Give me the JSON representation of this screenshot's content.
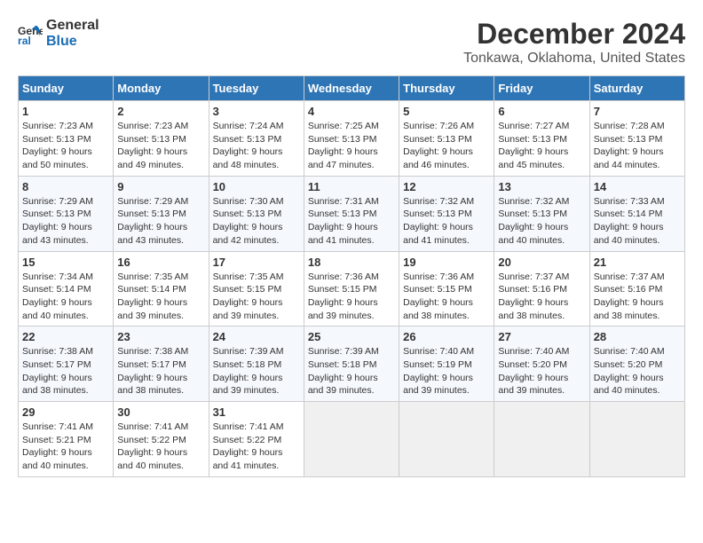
{
  "header": {
    "logo_line1": "General",
    "logo_line2": "Blue",
    "title": "December 2024",
    "subtitle": "Tonkawa, Oklahoma, United States"
  },
  "weekdays": [
    "Sunday",
    "Monday",
    "Tuesday",
    "Wednesday",
    "Thursday",
    "Friday",
    "Saturday"
  ],
  "weeks": [
    [
      {
        "day": 1,
        "sunrise": "Sunrise: 7:23 AM",
        "sunset": "Sunset: 5:13 PM",
        "daylight": "Daylight: 9 hours and 50 minutes."
      },
      {
        "day": 2,
        "sunrise": "Sunrise: 7:23 AM",
        "sunset": "Sunset: 5:13 PM",
        "daylight": "Daylight: 9 hours and 49 minutes."
      },
      {
        "day": 3,
        "sunrise": "Sunrise: 7:24 AM",
        "sunset": "Sunset: 5:13 PM",
        "daylight": "Daylight: 9 hours and 48 minutes."
      },
      {
        "day": 4,
        "sunrise": "Sunrise: 7:25 AM",
        "sunset": "Sunset: 5:13 PM",
        "daylight": "Daylight: 9 hours and 47 minutes."
      },
      {
        "day": 5,
        "sunrise": "Sunrise: 7:26 AM",
        "sunset": "Sunset: 5:13 PM",
        "daylight": "Daylight: 9 hours and 46 minutes."
      },
      {
        "day": 6,
        "sunrise": "Sunrise: 7:27 AM",
        "sunset": "Sunset: 5:13 PM",
        "daylight": "Daylight: 9 hours and 45 minutes."
      },
      {
        "day": 7,
        "sunrise": "Sunrise: 7:28 AM",
        "sunset": "Sunset: 5:13 PM",
        "daylight": "Daylight: 9 hours and 44 minutes."
      }
    ],
    [
      {
        "day": 8,
        "sunrise": "Sunrise: 7:29 AM",
        "sunset": "Sunset: 5:13 PM",
        "daylight": "Daylight: 9 hours and 43 minutes."
      },
      {
        "day": 9,
        "sunrise": "Sunrise: 7:29 AM",
        "sunset": "Sunset: 5:13 PM",
        "daylight": "Daylight: 9 hours and 43 minutes."
      },
      {
        "day": 10,
        "sunrise": "Sunrise: 7:30 AM",
        "sunset": "Sunset: 5:13 PM",
        "daylight": "Daylight: 9 hours and 42 minutes."
      },
      {
        "day": 11,
        "sunrise": "Sunrise: 7:31 AM",
        "sunset": "Sunset: 5:13 PM",
        "daylight": "Daylight: 9 hours and 41 minutes."
      },
      {
        "day": 12,
        "sunrise": "Sunrise: 7:32 AM",
        "sunset": "Sunset: 5:13 PM",
        "daylight": "Daylight: 9 hours and 41 minutes."
      },
      {
        "day": 13,
        "sunrise": "Sunrise: 7:32 AM",
        "sunset": "Sunset: 5:13 PM",
        "daylight": "Daylight: 9 hours and 40 minutes."
      },
      {
        "day": 14,
        "sunrise": "Sunrise: 7:33 AM",
        "sunset": "Sunset: 5:14 PM",
        "daylight": "Daylight: 9 hours and 40 minutes."
      }
    ],
    [
      {
        "day": 15,
        "sunrise": "Sunrise: 7:34 AM",
        "sunset": "Sunset: 5:14 PM",
        "daylight": "Daylight: 9 hours and 40 minutes."
      },
      {
        "day": 16,
        "sunrise": "Sunrise: 7:35 AM",
        "sunset": "Sunset: 5:14 PM",
        "daylight": "Daylight: 9 hours and 39 minutes."
      },
      {
        "day": 17,
        "sunrise": "Sunrise: 7:35 AM",
        "sunset": "Sunset: 5:15 PM",
        "daylight": "Daylight: 9 hours and 39 minutes."
      },
      {
        "day": 18,
        "sunrise": "Sunrise: 7:36 AM",
        "sunset": "Sunset: 5:15 PM",
        "daylight": "Daylight: 9 hours and 39 minutes."
      },
      {
        "day": 19,
        "sunrise": "Sunrise: 7:36 AM",
        "sunset": "Sunset: 5:15 PM",
        "daylight": "Daylight: 9 hours and 38 minutes."
      },
      {
        "day": 20,
        "sunrise": "Sunrise: 7:37 AM",
        "sunset": "Sunset: 5:16 PM",
        "daylight": "Daylight: 9 hours and 38 minutes."
      },
      {
        "day": 21,
        "sunrise": "Sunrise: 7:37 AM",
        "sunset": "Sunset: 5:16 PM",
        "daylight": "Daylight: 9 hours and 38 minutes."
      }
    ],
    [
      {
        "day": 22,
        "sunrise": "Sunrise: 7:38 AM",
        "sunset": "Sunset: 5:17 PM",
        "daylight": "Daylight: 9 hours and 38 minutes."
      },
      {
        "day": 23,
        "sunrise": "Sunrise: 7:38 AM",
        "sunset": "Sunset: 5:17 PM",
        "daylight": "Daylight: 9 hours and 38 minutes."
      },
      {
        "day": 24,
        "sunrise": "Sunrise: 7:39 AM",
        "sunset": "Sunset: 5:18 PM",
        "daylight": "Daylight: 9 hours and 39 minutes."
      },
      {
        "day": 25,
        "sunrise": "Sunrise: 7:39 AM",
        "sunset": "Sunset: 5:18 PM",
        "daylight": "Daylight: 9 hours and 39 minutes."
      },
      {
        "day": 26,
        "sunrise": "Sunrise: 7:40 AM",
        "sunset": "Sunset: 5:19 PM",
        "daylight": "Daylight: 9 hours and 39 minutes."
      },
      {
        "day": 27,
        "sunrise": "Sunrise: 7:40 AM",
        "sunset": "Sunset: 5:20 PM",
        "daylight": "Daylight: 9 hours and 39 minutes."
      },
      {
        "day": 28,
        "sunrise": "Sunrise: 7:40 AM",
        "sunset": "Sunset: 5:20 PM",
        "daylight": "Daylight: 9 hours and 40 minutes."
      }
    ],
    [
      {
        "day": 29,
        "sunrise": "Sunrise: 7:41 AM",
        "sunset": "Sunset: 5:21 PM",
        "daylight": "Daylight: 9 hours and 40 minutes."
      },
      {
        "day": 30,
        "sunrise": "Sunrise: 7:41 AM",
        "sunset": "Sunset: 5:22 PM",
        "daylight": "Daylight: 9 hours and 40 minutes."
      },
      {
        "day": 31,
        "sunrise": "Sunrise: 7:41 AM",
        "sunset": "Sunset: 5:22 PM",
        "daylight": "Daylight: 9 hours and 41 minutes."
      },
      null,
      null,
      null,
      null
    ]
  ]
}
